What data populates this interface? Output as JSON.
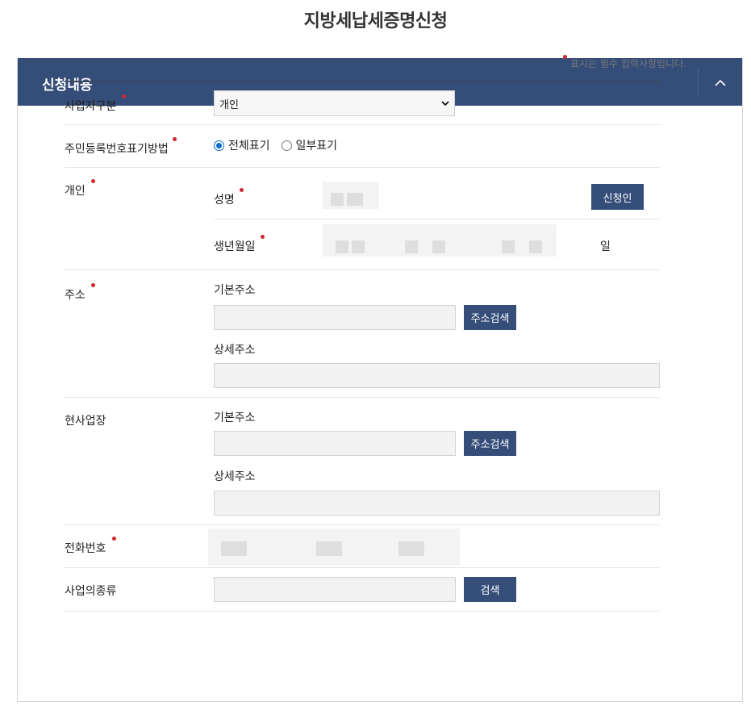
{
  "page": {
    "title": "지방세납세증명신청"
  },
  "panel": {
    "title": "신청내용"
  },
  "required_note": "표시는 필수 입력사항입니다.",
  "form": {
    "business_type": {
      "label": "사업자구분",
      "selected": "개인"
    },
    "resident_display": {
      "label": "주민등록번호표기방법",
      "options": [
        "전체표기",
        "일부표기"
      ],
      "selected_index": 0
    },
    "individual": {
      "label": "개인",
      "name_label": "성명",
      "applicant_button": "신청인",
      "birth_label": "생년월일",
      "day_suffix": "일"
    },
    "address": {
      "label": "주소",
      "basic_label": "기본주소",
      "search_button": "주소검색",
      "detail_label": "상세주소"
    },
    "workplace": {
      "label": "현사업장",
      "basic_label": "기본주소",
      "search_button": "주소검색",
      "detail_label": "상세주소"
    },
    "phone": {
      "label": "전화번호"
    },
    "business_kind": {
      "label": "사업의종류",
      "search_button": "검색"
    }
  },
  "colors": {
    "header_bg": "#344d79",
    "button_bg": "#344d79",
    "required_dot": "#d0262d",
    "radio_checked": "#0a6ad0"
  },
  "icons": {
    "collapse": "chevron-up-icon",
    "select": "chevron-down-icon"
  }
}
